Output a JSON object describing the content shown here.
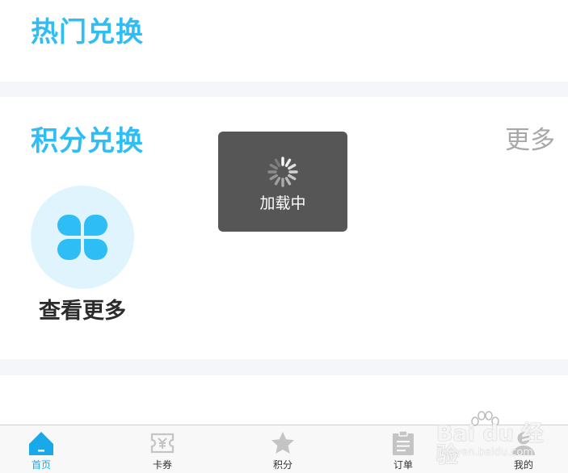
{
  "hot_section": {
    "title": "热门兑换"
  },
  "points_section": {
    "title": "积分兑换",
    "more_label": "更多",
    "see_more_label": "查看更多"
  },
  "loading_toast": {
    "text": "加载中"
  },
  "tabbar": {
    "active_tab": "首页",
    "tabs": [
      {
        "label": "首页",
        "icon": "home-icon"
      },
      {
        "label": "卡券",
        "icon": "coupon-icon"
      },
      {
        "label": "积分",
        "icon": "star-icon"
      },
      {
        "label": "订单",
        "icon": "clipboard-icon"
      },
      {
        "label": "我的",
        "icon": "user-icon"
      }
    ]
  },
  "watermark": {
    "text": "Bai du 经验",
    "url": "jingyan.baidu.com"
  },
  "colors": {
    "accent": "#2ebdf5",
    "active_tab": "#1aa9e8",
    "inactive_icon": "#c4c4c4",
    "more_link": "#a8a8a8",
    "toast_bg": "#484848",
    "page_bg": "#f5f6f9"
  }
}
